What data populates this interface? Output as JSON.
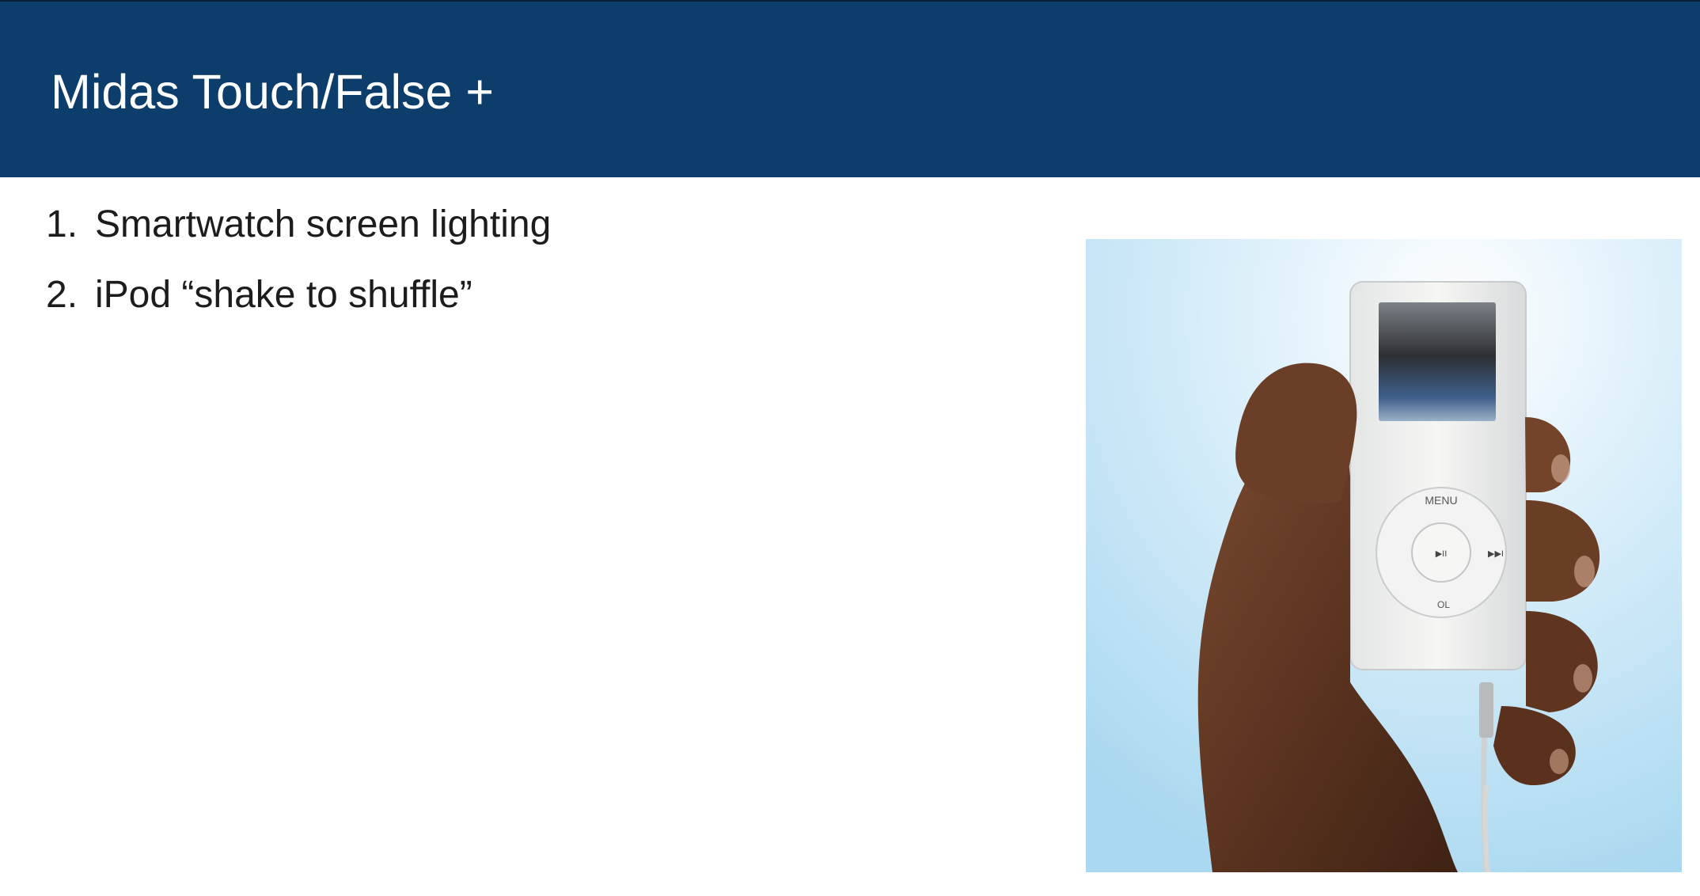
{
  "slide": {
    "title": "Midas Touch/False +",
    "title_bar_color": "#0d3d6b",
    "items": [
      {
        "number": "1.",
        "text": "Smartwatch screen lighting"
      },
      {
        "number": "2.",
        "text": "iPod “shake to shuffle”"
      }
    ],
    "photo": {
      "wheel_labels": {
        "menu": "MENU",
        "play_pause": "▶II",
        "next": "▶▶I",
        "vol": "OL"
      }
    }
  }
}
